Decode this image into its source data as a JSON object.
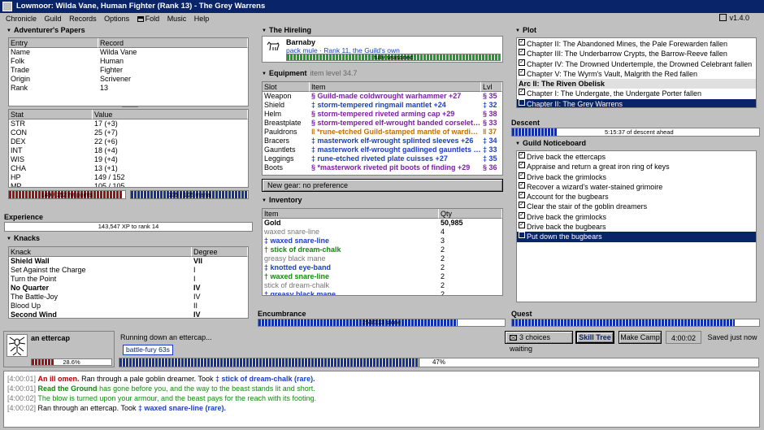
{
  "window": {
    "title": "Lowmoor: Wilda Vane, Human Fighter (Rank 13) - The Grey Warrens",
    "version": "v1.4.0"
  },
  "menu": [
    "Chronicle",
    "Guild",
    "Records",
    "Options",
    "Fold",
    "Music",
    "Help"
  ],
  "papers": {
    "title": "Adventurer's Papers",
    "headers": [
      "Entry",
      "Record"
    ],
    "rows": [
      [
        "Name",
        "Wilda Vane"
      ],
      [
        "Folk",
        "Human"
      ],
      [
        "Trade",
        "Fighter"
      ],
      [
        "Origin",
        "Scrivener"
      ],
      [
        "Rank",
        "13"
      ]
    ],
    "stat_headers": [
      "Stat",
      "Value"
    ],
    "stats": [
      [
        "STR",
        "17 (+3)"
      ],
      [
        "CON",
        "25 (+7)"
      ],
      [
        "DEX",
        "22 (+6)"
      ],
      [
        "INT",
        "18 (+4)"
      ],
      [
        "WIS",
        "19 (+4)"
      ],
      [
        "CHA",
        "13 (+1)"
      ],
      [
        "HP",
        "149 / 152"
      ],
      [
        "MP",
        "105 / 105"
      ]
    ],
    "hp_label": "149 / 152 hit points",
    "hp_fraction": 0.98,
    "mp_label": "105 / 105 mana",
    "mp_fraction": 1.0
  },
  "experience": {
    "title": "Experience",
    "label": "143,547 XP to rank 14",
    "fraction": 0.0
  },
  "knacks": {
    "title": "Knacks",
    "headers": [
      "Knack",
      "Degree"
    ],
    "rows": [
      {
        "name": "Shield Wall",
        "degree": "VII",
        "bold": true
      },
      {
        "name": "Set Against the Charge",
        "degree": "I",
        "bold": false
      },
      {
        "name": "Turn the Point",
        "degree": "I",
        "bold": false
      },
      {
        "name": "No Quarter",
        "degree": "IV",
        "bold": true
      },
      {
        "name": "The Battle-Joy",
        "degree": "IV",
        "bold": false
      },
      {
        "name": "Blood Up",
        "degree": "II",
        "bold": false
      },
      {
        "name": "Second Wind",
        "degree": "IV",
        "bold": true
      }
    ]
  },
  "hireling": {
    "title": "The Hireling",
    "name": "Barnaby",
    "desc": "pack mule · Rank 11, the Guild's own",
    "bar_label": "fully seasoned",
    "fraction": 1.0
  },
  "equipment": {
    "title": "Equipment",
    "subtitle": "item level 34.7",
    "headers": [
      "Slot",
      "Item",
      "Lvl"
    ],
    "rows": [
      {
        "slot": "Weapon",
        "item": "§ Guild-made coldwrought warhammer +27",
        "lvl": "§ 35",
        "cls": "purple"
      },
      {
        "slot": "Shield",
        "item": "‡ storm-tempered ringmail mantlet +24",
        "lvl": "‡ 32",
        "cls": "blue"
      },
      {
        "slot": "Helm",
        "item": "§ storm-tempered riveted arming cap +29",
        "lvl": "§ 38",
        "cls": "purple"
      },
      {
        "slot": "Breastplate",
        "item": "§ storm-tempered elf-wrought banded corselet +26",
        "lvl": "§ 33",
        "cls": "purple"
      },
      {
        "slot": "Pauldrons",
        "item": "‖ *rune-etched Guild-stamped mantle of warding +30",
        "lvl": "‖ 37",
        "cls": "orange"
      },
      {
        "slot": "Bracers",
        "item": "‡ masterwork elf-wrought splinted sleeves +26",
        "lvl": "‡ 34",
        "cls": "blue"
      },
      {
        "slot": "Gauntlets",
        "item": "‡ masterwork elf-wrought gadlinged gauntlets +25",
        "lvl": "‡ 33",
        "cls": "blue"
      },
      {
        "slot": "Leggings",
        "item": "‡ rune-etched riveted plate cuisses +27",
        "lvl": "‡ 35",
        "cls": "blue"
      },
      {
        "slot": "Boots",
        "item": "§ *masterwork riveted pit boots of finding +29",
        "lvl": "§ 36",
        "cls": "purple"
      }
    ],
    "new_gear": "New gear: no preference"
  },
  "inventory": {
    "title": "Inventory",
    "headers": [
      "Item",
      "Qty"
    ],
    "rows": [
      {
        "item": "Gold",
        "qty": "50,985",
        "cls": "b"
      },
      {
        "item": "waxed snare-line",
        "qty": "4",
        "cls": "grey"
      },
      {
        "item": "‡ waxed snare-line",
        "qty": "3",
        "cls": "blue"
      },
      {
        "item": "† stick of dream-chalk",
        "qty": "2",
        "cls": "green"
      },
      {
        "item": "greasy black mane",
        "qty": "2",
        "cls": "grey"
      },
      {
        "item": "‡ knotted eye-band",
        "qty": "2",
        "cls": "blue"
      },
      {
        "item": "† waxed snare-line",
        "qty": "2",
        "cls": "green"
      },
      {
        "item": "stick of dream-chalk",
        "qty": "2",
        "cls": "grey"
      },
      {
        "item": "‡ greasy black mane",
        "qty": "2",
        "cls": "blue"
      }
    ]
  },
  "encumbrance": {
    "title": "Encumbrance",
    "label": "253/313 stone",
    "fraction": 0.81
  },
  "plot": {
    "title": "Plot",
    "items": [
      {
        "text": "Chapter II: The Abandoned Mines, the Pale Forewarden fallen",
        "type": "done"
      },
      {
        "text": "Chapter III: The Underbarrow Crypts, the Barrow-Reeve fallen",
        "type": "done"
      },
      {
        "text": "Chapter IV: The Drowned Undertemple, the Drowned Celebrant fallen",
        "type": "done"
      },
      {
        "text": "Chapter V: The Wyrm's Vault, Malgrith the Red fallen",
        "type": "done"
      },
      {
        "text": "Arc II: The Riven Obelisk",
        "type": "arc"
      },
      {
        "text": "Chapter I: The Undergate, the Undergate Porter fallen",
        "type": "done"
      },
      {
        "text": "Chapter II: The Grey Warrens",
        "type": "current"
      }
    ]
  },
  "descent": {
    "title": "Descent",
    "label": "5:15:37 of descent ahead",
    "fraction": 0.18
  },
  "noticeboard": {
    "title": "Guild Noticeboard",
    "items": [
      {
        "text": "Drive back the ettercaps",
        "type": "done"
      },
      {
        "text": "Appraise and return a great iron ring of keys",
        "type": "done"
      },
      {
        "text": "Drive back the grimlocks",
        "type": "done"
      },
      {
        "text": "Recover a wizard's water-stained grimoire",
        "type": "done"
      },
      {
        "text": "Account for the bugbears",
        "type": "done"
      },
      {
        "text": "Clear the stair of the goblin dreamers",
        "type": "done"
      },
      {
        "text": "Drive back the grimlocks",
        "type": "done"
      },
      {
        "text": "Drive back the bugbears",
        "type": "done"
      },
      {
        "text": "Put down the bugbears",
        "type": "current"
      }
    ]
  },
  "quest": {
    "title": "Quest",
    "label": "",
    "fraction": 0.9
  },
  "foe": {
    "name": "an ettercap",
    "hp_label": "28.6%",
    "fraction": 0.28
  },
  "status": {
    "task": "Running down an ettercap...",
    "choices": "3 choices waiting",
    "skill_tree": "Skill Tree",
    "make_camp": "Make Camp",
    "clock": "4:00:02",
    "saved": "Saved just now",
    "buff": "battle-fury 63s",
    "progress_label": "47%",
    "progress_fraction": 0.47
  },
  "log": [
    {
      "time": "[4:00:01]",
      "parts": [
        {
          "t": "An ill omen.",
          "c": "red"
        },
        {
          "t": " Ran through a pale goblin dreamer. Took ",
          "c": ""
        },
        {
          "t": "‡ stick of dream-chalk (rare).",
          "c": "blue"
        }
      ]
    },
    {
      "time": "[4:00:01]",
      "parts": [
        {
          "t": "Read the Ground",
          "c": "green"
        },
        {
          "t": " has gone before you, and the way to the beast stands lit and short.",
          "c": "greentxt"
        }
      ]
    },
    {
      "time": "[4:00:02]",
      "parts": [
        {
          "t": "The blow is turned upon your armour, and the beast pays for the reach with its footing.",
          "c": "greentxt"
        }
      ]
    },
    {
      "time": "[4:00:02]",
      "parts": [
        {
          "t": "Ran through an ettercap. Took ",
          "c": ""
        },
        {
          "t": "‡ waxed snare-line (rare).",
          "c": "blue"
        }
      ]
    }
  ],
  "colors": {
    "title_bg": "#0a246a",
    "face": "#c0c0c0",
    "bar_blue": "#1330a6",
    "bar_red": "#a01010",
    "bar_green": "#17a02b"
  }
}
